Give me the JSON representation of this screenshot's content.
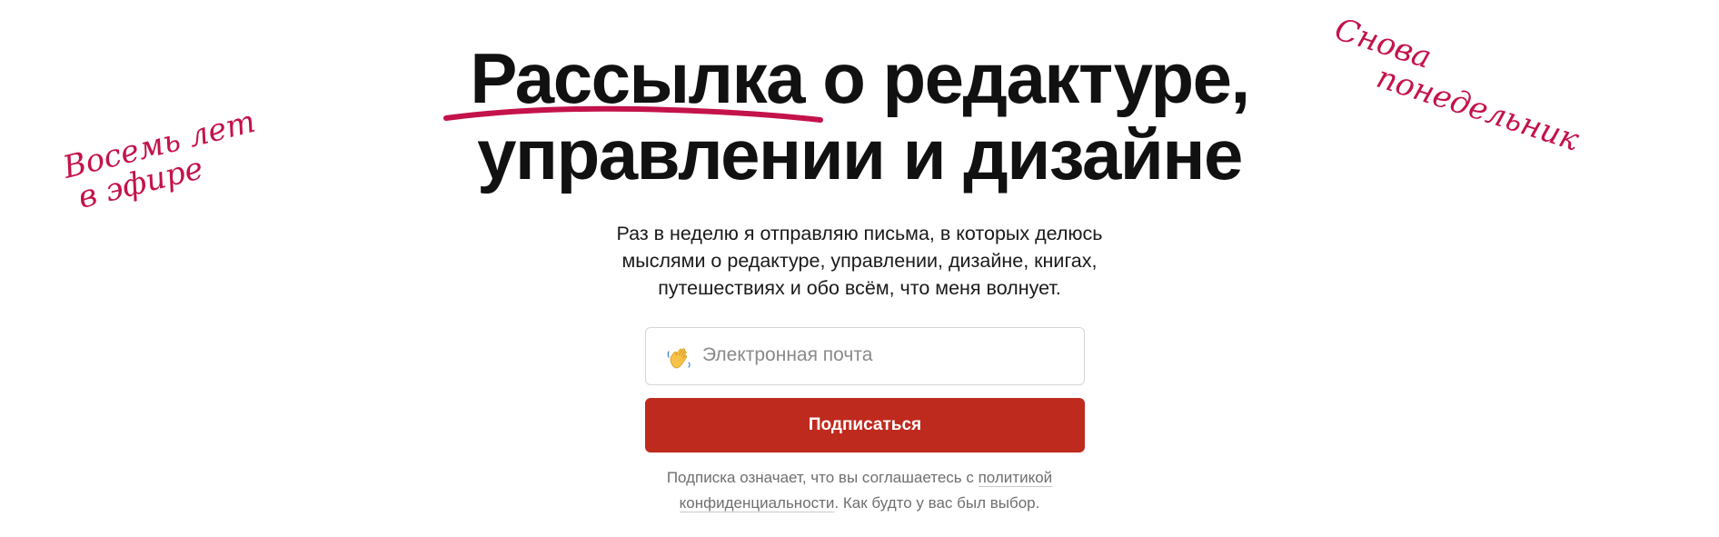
{
  "title": {
    "highlight": "Рассылка",
    "line1_rest": " о редактуре,",
    "line2": "управлении и дизайне"
  },
  "lead": {
    "line1": "Раз в неделю я отправляю письма, в которых делюсь",
    "line2": "мыслями о редактуре, управлении, дизайне, книгах,",
    "line3": "путешествиях и обо всём, что меня волнует."
  },
  "form": {
    "email_placeholder": "Электронная почта",
    "email_value": "",
    "email_icon": "waving-hand-icon",
    "submit_label": "Подписаться"
  },
  "note": {
    "part1": "Подписка означает, что вы соглашаетесь с ",
    "link1": "политикой",
    "link2": "конфиденциальности",
    "part2": ". Как будто у вас был выбор."
  },
  "handwritten": {
    "left_line1": "Восемь лет",
    "left_line2": "в эфире",
    "right_line1": "Снова",
    "right_line2": "понедельник"
  },
  "colors": {
    "accent": "#c4124a",
    "button": "#bf2a1e",
    "text": "#111111",
    "muted": "#6f6f6f"
  }
}
